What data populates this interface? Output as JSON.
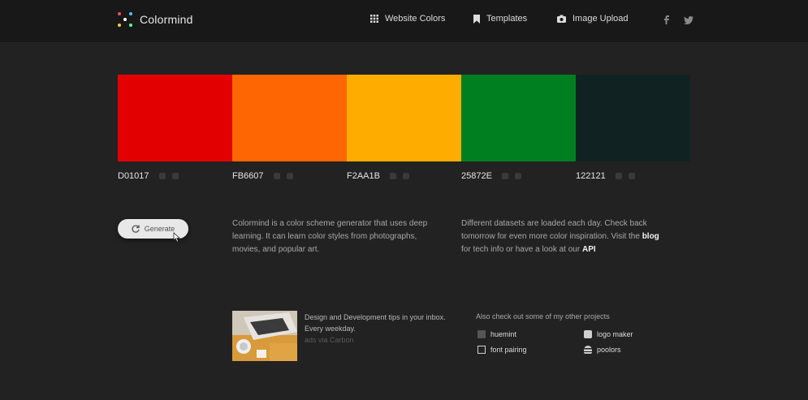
{
  "app": {
    "name": "Colormind"
  },
  "nav": {
    "website_colors": "Website Colors",
    "templates": "Templates",
    "image_upload": "Image Upload"
  },
  "palette": [
    {
      "hex": "D01017",
      "color": "#E30000"
    },
    {
      "hex": "FB6607",
      "color": "#FD6602"
    },
    {
      "hex": "F2AA1B",
      "color": "#FEAC00"
    },
    {
      "hex": "25872E",
      "color": "#007F20"
    },
    {
      "hex": "122121",
      "color": "#112222"
    }
  ],
  "generate": {
    "label": "Generate"
  },
  "about": {
    "text": "Colormind is a color scheme generator that uses deep learning. It can learn color styles from photographs, movies, and popular art."
  },
  "daily": {
    "before": "Different datasets are loaded each day. Check back tomorrow for even more color inspiration. Visit the ",
    "blog": "blog",
    "middle": " for tech info or have a look at our ",
    "api": "API"
  },
  "newsletter": {
    "line1": "Design and Development tips in your inbox.",
    "line2": "Every weekday.",
    "line3": "ads via Carbon"
  },
  "projects": {
    "title": "Also check out some of my other projects",
    "items": {
      "huemint": "huemint",
      "logo_maker": "logo maker",
      "font_pairing": "font pairing",
      "poolors": "poolors"
    }
  }
}
